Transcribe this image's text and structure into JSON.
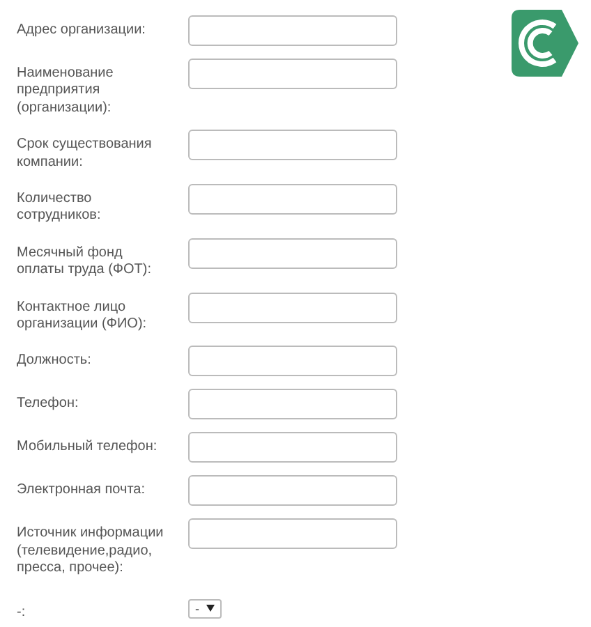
{
  "fields": [
    {
      "kind": "text",
      "label": "Адрес организации:"
    },
    {
      "kind": "text",
      "label": "Наименование предприятия (организации):"
    },
    {
      "kind": "text",
      "label": "Срок существования компании:"
    },
    {
      "kind": "text",
      "label": "Количество сотрудников:"
    },
    {
      "kind": "text",
      "label": "Месячный фонд оплаты труда (ФОТ):"
    },
    {
      "kind": "text",
      "label": "Контактное лицо организации (ФИО):"
    },
    {
      "kind": "text",
      "label": "Должность:"
    },
    {
      "kind": "text",
      "label": "Телефон:"
    },
    {
      "kind": "text",
      "label": "Мобильный телефон:"
    },
    {
      "kind": "text",
      "label": "Электронная почта:"
    },
    {
      "kind": "text",
      "label": "Источник информации (телевидение,радио, пресса, прочее):"
    },
    {
      "kind": "select",
      "label": "-:",
      "value": "-"
    }
  ]
}
